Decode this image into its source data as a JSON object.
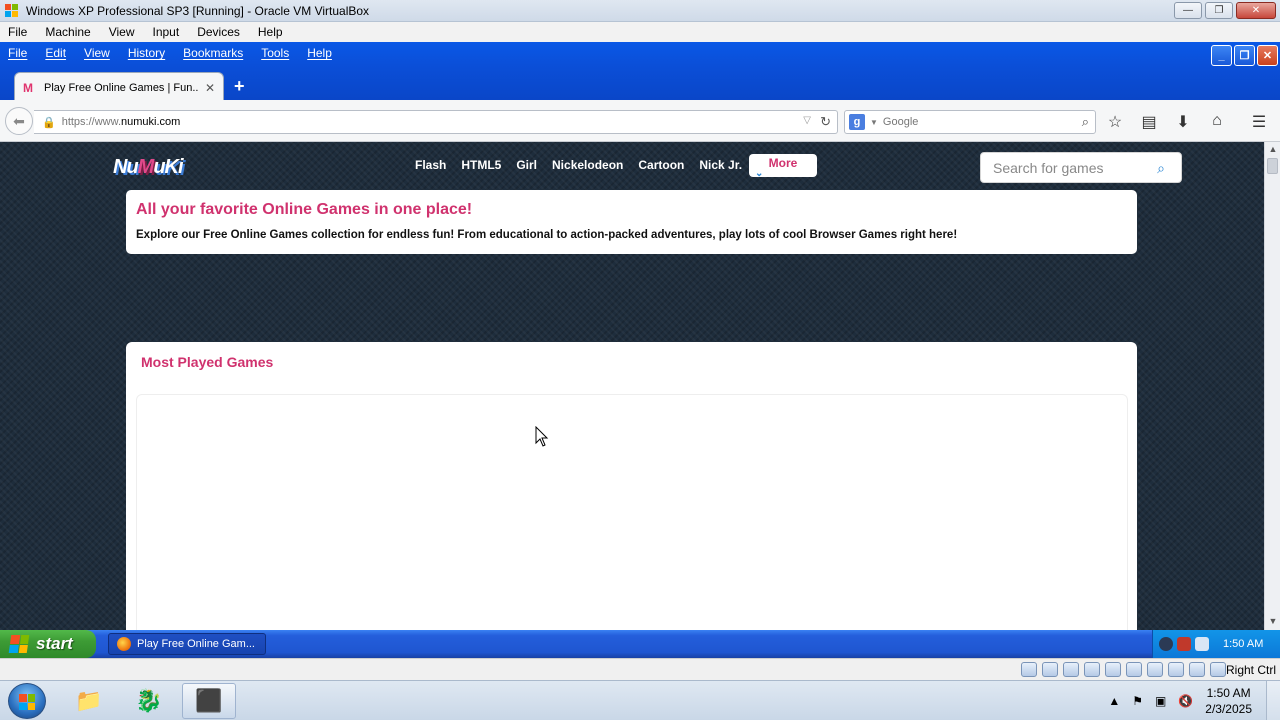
{
  "host_window": {
    "title": "Windows XP Professional SP3 [Running] - Oracle VM VirtualBox",
    "menu": [
      "File",
      "Machine",
      "View",
      "Input",
      "Devices",
      "Help"
    ],
    "buttons": {
      "minimize": "—",
      "restore": "❐",
      "close": "✕"
    }
  },
  "firefox": {
    "menu": [
      "File",
      "Edit",
      "View",
      "History",
      "Bookmarks",
      "Tools",
      "Help"
    ],
    "tab": {
      "title": "Play Free Online Games | Fun...",
      "close": "✕"
    },
    "new_tab": "+",
    "url": {
      "protocol": "https://www.",
      "host": "numuki.com"
    },
    "search": {
      "engine_glyph": "g",
      "placeholder": "Google"
    }
  },
  "site": {
    "logo": {
      "part1": "Nu",
      "part2": "M",
      "part3": "uKi"
    },
    "nav": [
      "Flash",
      "HTML5",
      "Girl",
      "Nickelodeon",
      "Cartoon",
      "Nick Jr."
    ],
    "more": "More",
    "search_placeholder": "Search for games",
    "intro": {
      "title": "All your favorite Online Games in one place!",
      "text": "Explore our Free Online Games collection for endless fun! From educational to action-packed adventures, play lots of cool Browser Games right here!"
    },
    "most_played": {
      "title": "Most Played Games"
    }
  },
  "xp_taskbar": {
    "start": "start",
    "task": "Play Free Online Gam...",
    "clock": "1:50 AM"
  },
  "vb_status": {
    "host_key": "Right Ctrl"
  },
  "host_taskbar": {
    "time": "1:50 AM",
    "date": "2/3/2025"
  },
  "colors": {
    "accent_pink": "#d0326e",
    "page_bg": "#1e2d3c",
    "xp_blue": "#245edb"
  }
}
